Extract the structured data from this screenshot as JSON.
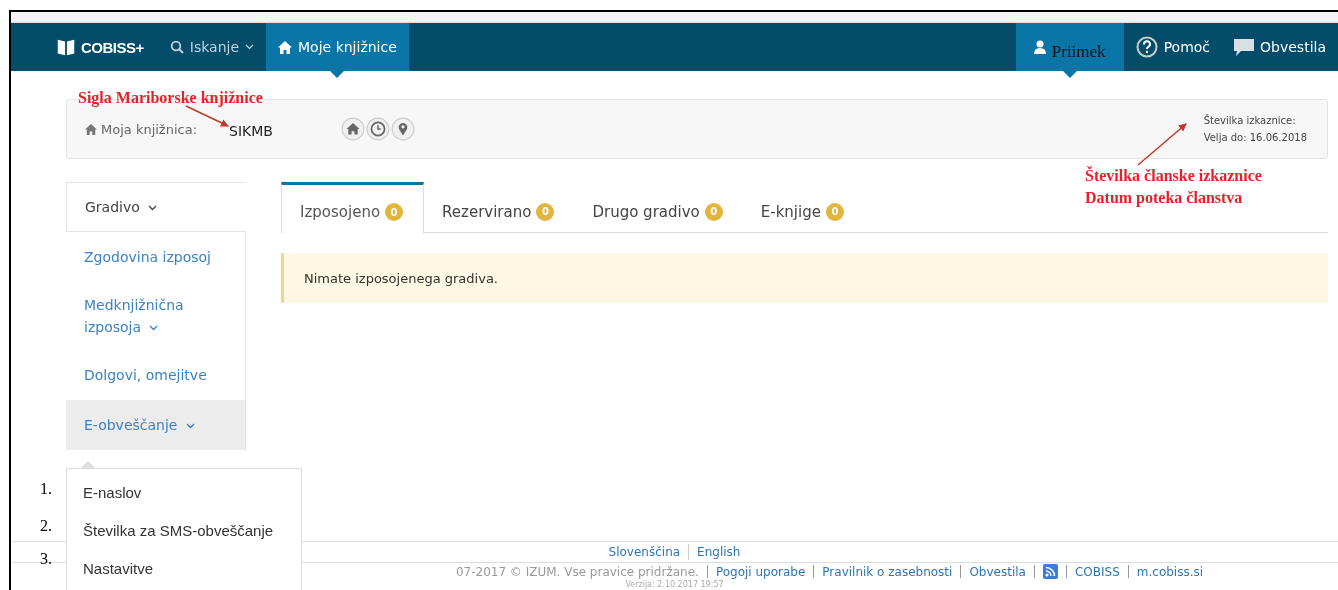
{
  "nav": {
    "logo": "COBISS+",
    "items": [
      {
        "label": "Iskanje",
        "kind": "search",
        "dropdown": true,
        "selected": false
      },
      {
        "label": "Moje knjižnice",
        "kind": "home",
        "dropdown": false,
        "selected": true
      }
    ],
    "right_items": [
      {
        "label": "Priimek",
        "kind": "user",
        "selected": true
      },
      {
        "label": "Pomoč",
        "kind": "help",
        "selected": false
      },
      {
        "label": "Obvestila",
        "kind": "chat",
        "selected": false
      }
    ]
  },
  "library_panel": {
    "label": "Moja knjižnica:",
    "value": "SIKMB",
    "card_label": "Številka izkaznice:",
    "valid_until": "Velja do: 16.06.2018"
  },
  "sidebar": {
    "items": [
      {
        "label": "Gradivo",
        "kind": "header",
        "dropdown": true,
        "selected": false
      },
      {
        "label": "Zgodovina izposoj",
        "kind": "link",
        "dropdown": false,
        "selected": false
      },
      {
        "label": "Medknjižnična izposoja",
        "kind": "link",
        "dropdown": true,
        "selected": false
      },
      {
        "label": "Dolgovi, omejitve",
        "kind": "link",
        "dropdown": false,
        "selected": false
      },
      {
        "label": "E-obveščanje",
        "kind": "link",
        "dropdown": true,
        "selected": true
      }
    ]
  },
  "dropdown_menu": {
    "items": [
      "E-naslov",
      "Številka za SMS-obveščanje",
      "Nastavitve"
    ]
  },
  "tabs": [
    {
      "label": "Izposojeno",
      "count": "0",
      "selected": true
    },
    {
      "label": "Rezervirano",
      "count": "0",
      "selected": false
    },
    {
      "label": "Drugo gradivo",
      "count": "0",
      "selected": false
    },
    {
      "label": "E-knjige",
      "count": "0",
      "selected": false
    }
  ],
  "alert": "Nimate izposojenega gradiva.",
  "footer": {
    "languages": [
      "Slovenščina",
      "English"
    ],
    "copyright": "07-2017 © IZUM. Vse pravice pridržane.",
    "links": [
      {
        "kind": "link",
        "label": "Pogoji uporabe"
      },
      {
        "kind": "link",
        "label": "Pravilnik o zasebnosti"
      },
      {
        "kind": "link",
        "label": "Obvestila"
      },
      {
        "kind": "rss"
      },
      {
        "kind": "link",
        "label": "COBISS"
      },
      {
        "kind": "link",
        "label": "m.cobiss.si"
      }
    ],
    "version": "Verzija: 2.10.2017 19:57"
  },
  "annotations": {
    "library_note": "Sigla Mariborske knjižnice",
    "card_note": [
      "Številka članske izkaznice",
      "Datum poteka članstva"
    ],
    "numbers": [
      "1.",
      "2.",
      "3."
    ]
  }
}
